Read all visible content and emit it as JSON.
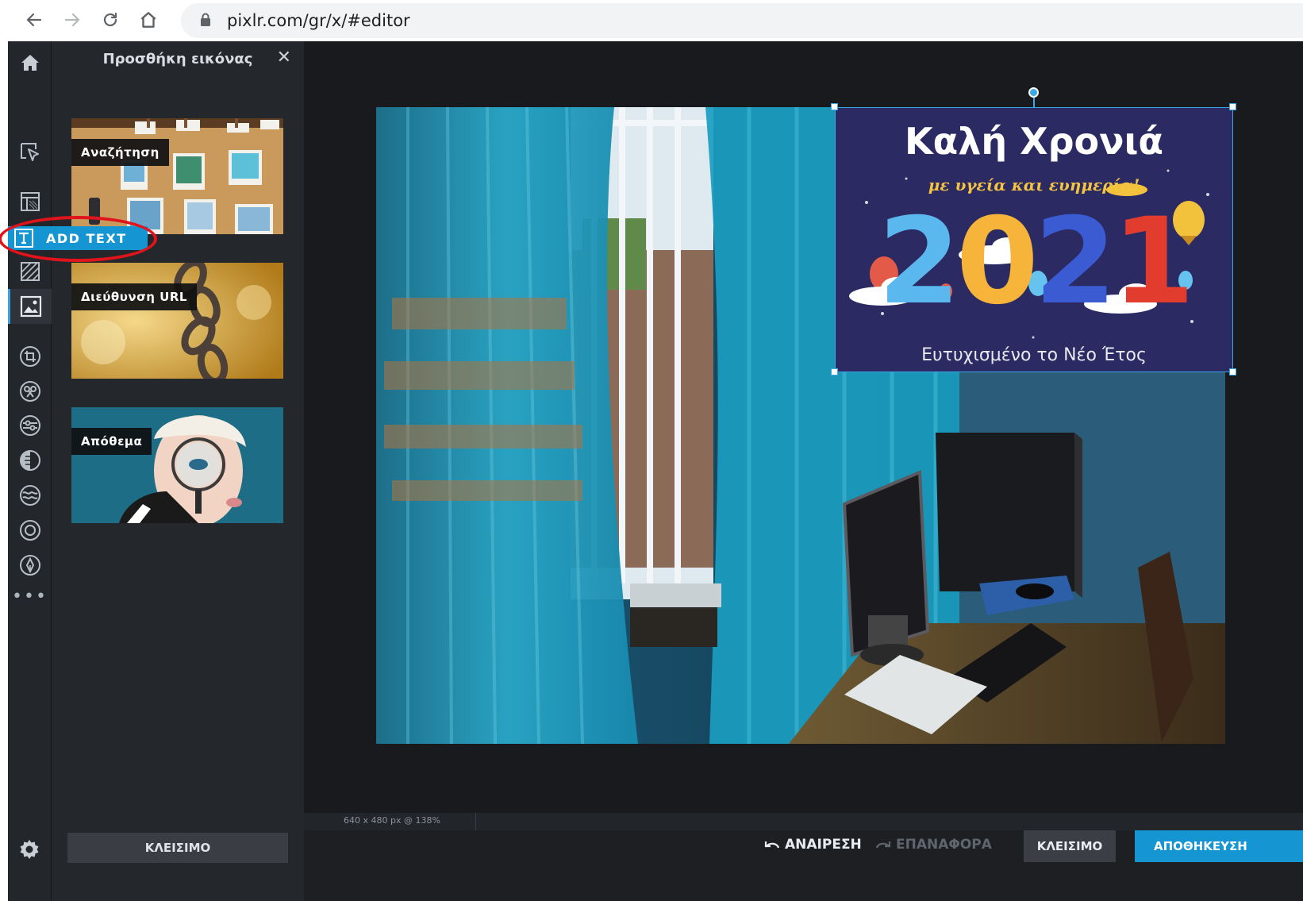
{
  "browser": {
    "url": "pixlr.com/gr/x/#editor",
    "icons": [
      "back-arrow-icon",
      "forward-arrow-icon",
      "reload-icon",
      "home-icon",
      "lock-icon"
    ]
  },
  "toolbar": {
    "add_text_label": "ADD TEXT",
    "more_label": "•••",
    "tools": [
      "home-icon",
      "arrange-icon",
      "layout-icon",
      "text-icon",
      "pattern-icon",
      "image-icon",
      "crop-icon",
      "cutout-icon",
      "adjust-icon",
      "filter-icon",
      "liquify-icon",
      "focus-icon",
      "draw-icon",
      "settings-icon"
    ]
  },
  "panel": {
    "title": "Προσθήκη εικόνας",
    "close": "✕",
    "cards": [
      {
        "label": "Αναζήτηση"
      },
      {
        "label": "Διεύθυνση URL"
      },
      {
        "label": "Απόθεμα"
      }
    ],
    "close_button": "ΚΛΕΙΣΙΜΟ"
  },
  "canvas": {
    "status": "640 x 480 px @ 138%",
    "overlay": {
      "title": "Καλή Χρονιά",
      "subtitle": "με υγεία και ευημερία!",
      "digit1": "2",
      "digit2": "0",
      "digit3": "2",
      "digit4": "1",
      "footer": "Ευτυχισμένο το Νέο Έτος"
    }
  },
  "bottom": {
    "undo": "ΑΝΑΙΡΕΣΗ",
    "redo": "ΕΠΑΝΑΦΟΡΑ",
    "close": "ΚΛΕΙΣΙΜΟ",
    "save": "ΑΠΟΘΗΚΕΥΣΗ"
  },
  "colors": {
    "accent": "#1596d2",
    "highlight": "#e0141a",
    "overlay_bg": "#2b2a63",
    "digit_blue_light": "#5bb8ef",
    "digit_orange": "#f6b43a",
    "digit_blue_dark": "#3a5bd1",
    "digit_red": "#e23c2f"
  }
}
